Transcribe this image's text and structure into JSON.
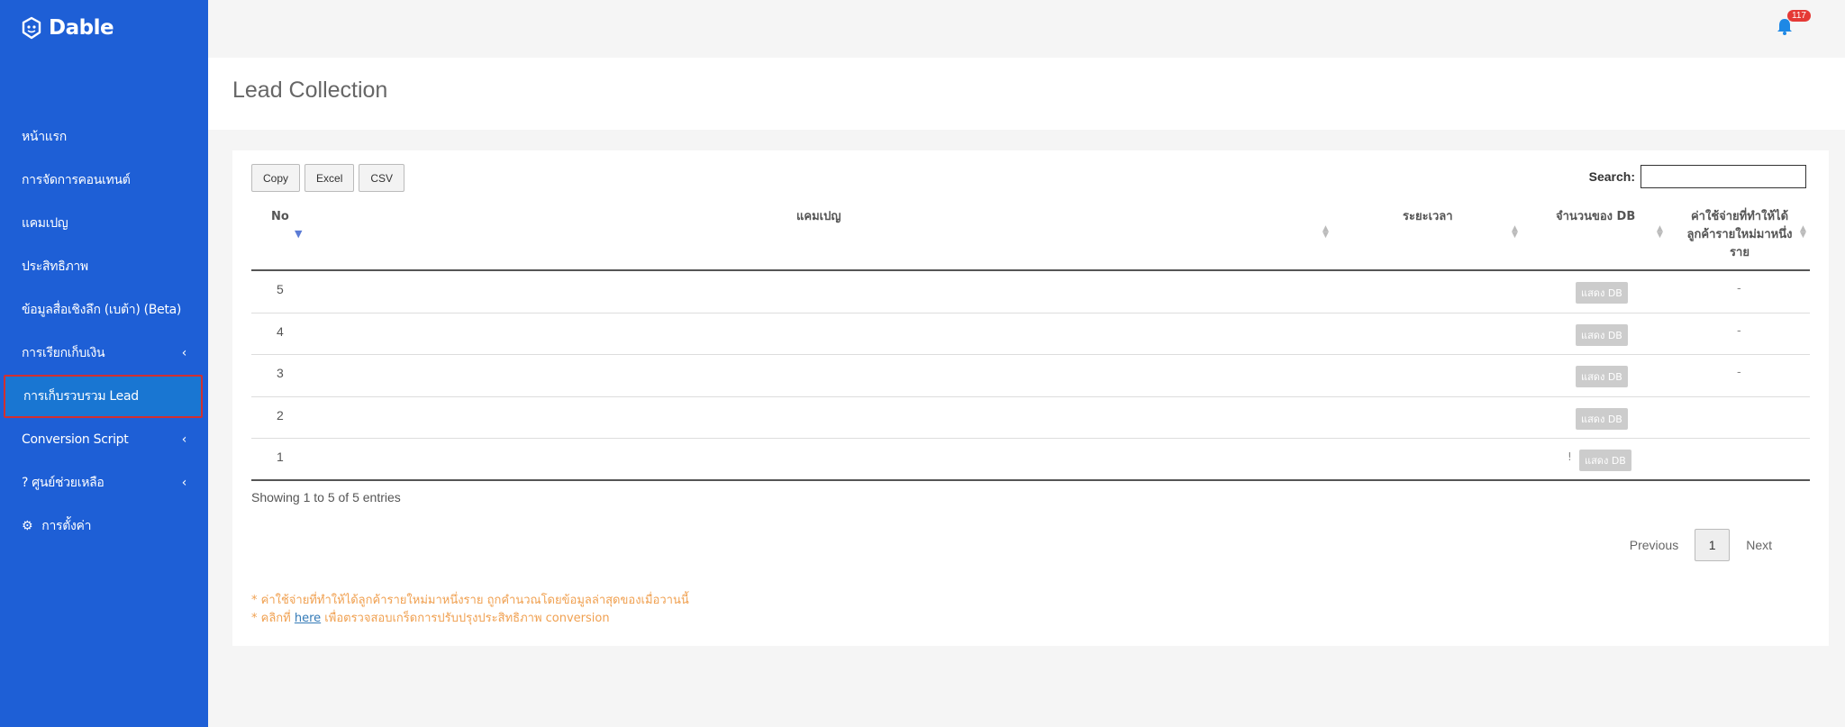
{
  "brand": {
    "name": "Dable"
  },
  "sidebar": {
    "items": [
      {
        "label": "หน้าแรก",
        "has_chevron": false,
        "active": false
      },
      {
        "label": "การจัดการคอนเทนต์",
        "has_chevron": false,
        "active": false
      },
      {
        "label": "แคมเปญ",
        "has_chevron": false,
        "active": false
      },
      {
        "label": "ประสิทธิภาพ",
        "has_chevron": false,
        "active": false
      },
      {
        "label": "ข้อมูลสื่อเชิงลึก (เบต้า) (Beta)",
        "has_chevron": false,
        "active": false
      },
      {
        "label": "การเรียกเก็บเงิน",
        "has_chevron": true,
        "active": false
      },
      {
        "label": "การเก็บรวบรวม Lead",
        "has_chevron": false,
        "active": true
      },
      {
        "label": "Conversion Script",
        "has_chevron": true,
        "active": false
      },
      {
        "label": "?  ศูนย์ช่วยเหลือ",
        "has_chevron": true,
        "active": false
      },
      {
        "label": "การตั้งค่า",
        "has_chevron": false,
        "active": false,
        "icon": "gear-icon"
      }
    ],
    "chevron_glyph": "‹"
  },
  "topbar": {
    "notification_count": "117"
  },
  "page": {
    "title": "Lead Collection"
  },
  "toolbar": {
    "buttons": [
      "Copy",
      "Excel",
      "CSV"
    ],
    "search_label": "Search:",
    "search_value": ""
  },
  "table": {
    "columns": [
      "No",
      "แคมเปญ",
      "ระยะเวลา",
      "จำนวนของ DB",
      "ค่าใช้จ่ายที่ทำให้ได้ลูกค้ารายใหม่มาหนึ่งราย"
    ],
    "rows": [
      {
        "no": "5",
        "db_label": "แสดง DB",
        "cost": "-"
      },
      {
        "no": "4",
        "db_label": "แสดง DB",
        "cost": "-"
      },
      {
        "no": "3",
        "db_label": "แสดง DB",
        "cost": "-"
      },
      {
        "no": "2",
        "db_label": "แสดง DB",
        "cost": ""
      },
      {
        "no": "1",
        "db_label": "แสดง DB",
        "cost": "",
        "prefix": "!"
      }
    ],
    "info": "Showing 1 to 5 of 5 entries"
  },
  "pagination": {
    "prev": "Previous",
    "current": "1",
    "next": "Next"
  },
  "notes": {
    "line1": "* ค่าใช้จ่ายที่ทำให้ได้ลูกค้ารายใหม่มาหนึ่งราย ถูกคำนวณโดยข้อมูลล่าสุดของเมื่อวานนี้",
    "line2_prefix": "* คลิกที่ ",
    "line2_link": "here",
    "line2_suffix": " เพื่อตรวจสอบเกร็ดการปรับปรุงประสิทธิภาพ conversion"
  },
  "colors": {
    "sidebar_bg": "#1E5FD6",
    "active_bg": "#1976D2",
    "active_border": "#D32F2F",
    "note_color": "#F0A050",
    "badge": "#E53935"
  }
}
